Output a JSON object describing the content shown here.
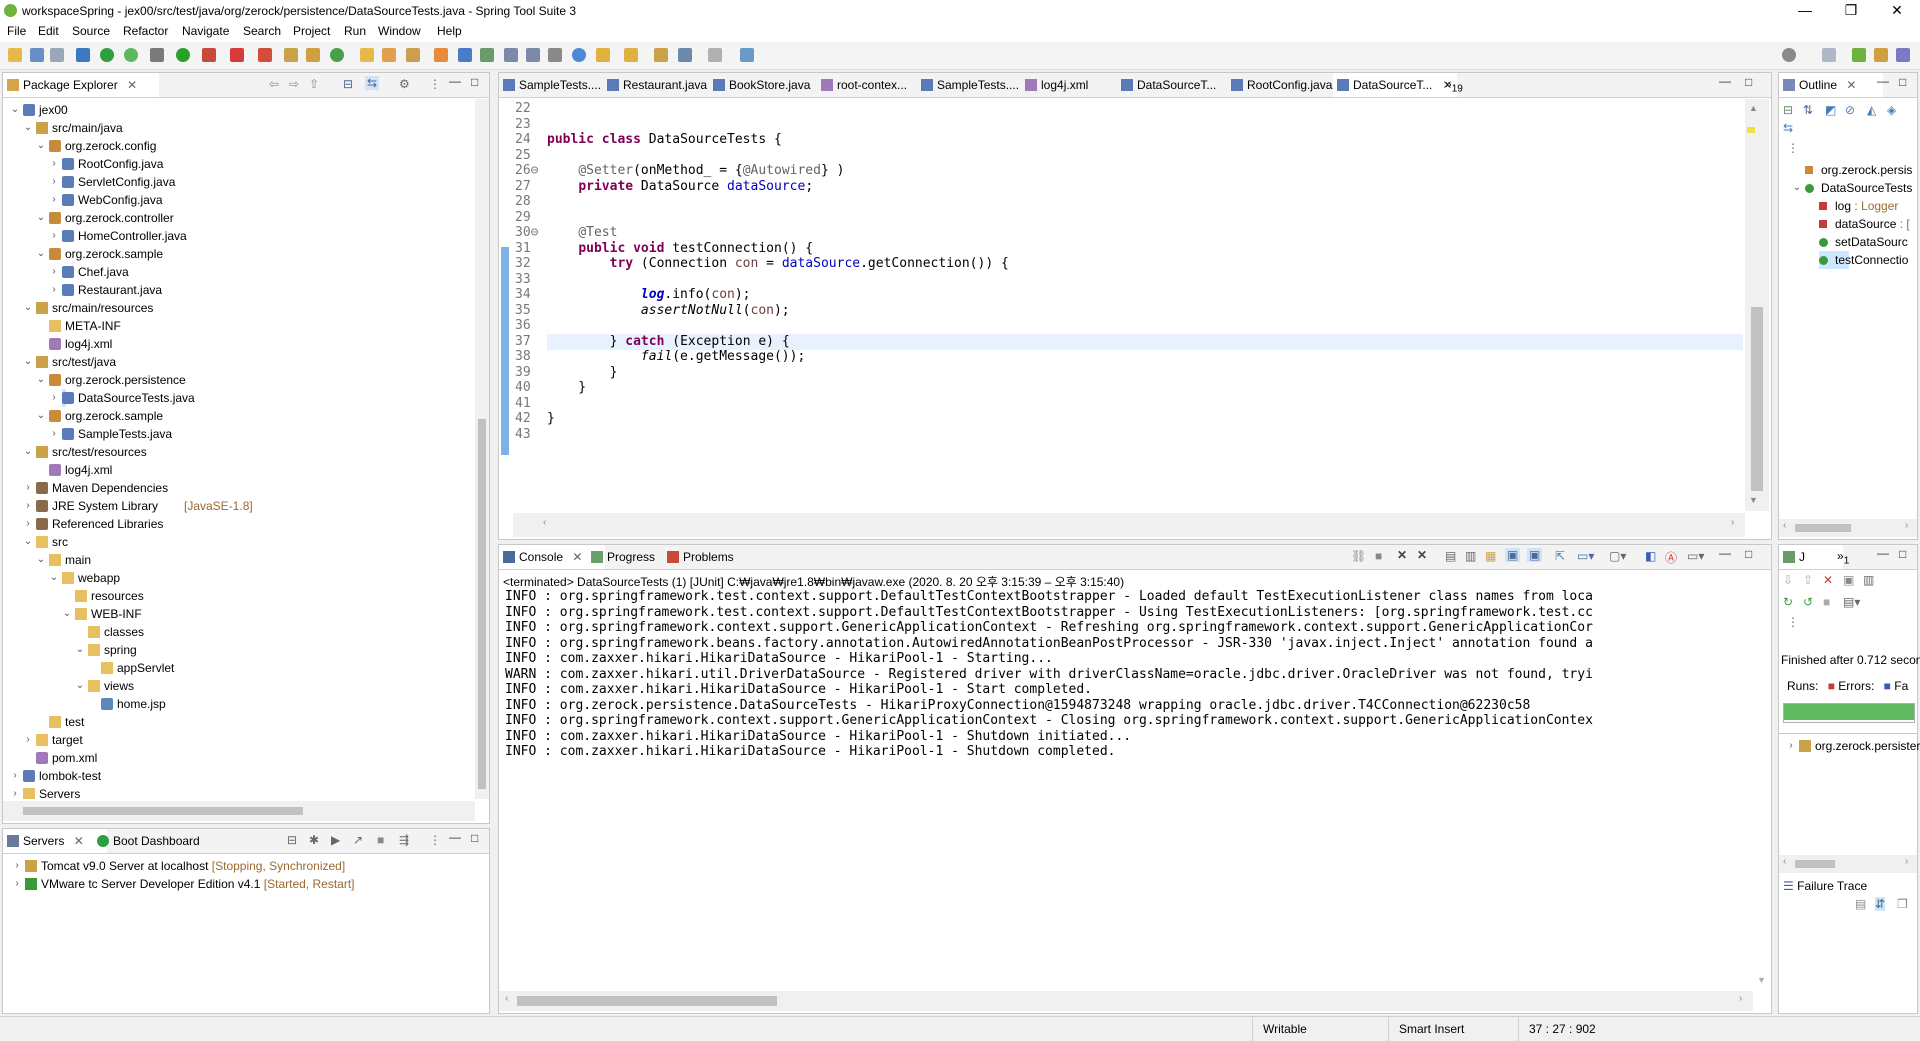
{
  "window": {
    "title": "workspaceSpring - jex00/src/test/java/org/zerock/persistence/DataSourceTests.java - Spring Tool Suite 3",
    "minimize": "—",
    "maximize": "❐",
    "close": "✕"
  },
  "menu": [
    "File",
    "Edit",
    "Source",
    "Refactor",
    "Navigate",
    "Search",
    "Project",
    "Run",
    "Window",
    "Help"
  ],
  "package_explorer": {
    "title": "Package Explorer",
    "items": [
      {
        "label": "jex00",
        "depth": 0,
        "arrow": "v",
        "icon": "project-icon"
      },
      {
        "label": "src/main/java",
        "depth": 1,
        "arrow": "v",
        "icon": "source-folder-icon"
      },
      {
        "label": "org.zerock.config",
        "depth": 2,
        "arrow": "v",
        "icon": "package-icon"
      },
      {
        "label": "RootConfig.java",
        "depth": 3,
        "arrow": ">",
        "icon": "java-file-icon"
      },
      {
        "label": "ServletConfig.java",
        "depth": 3,
        "arrow": ">",
        "icon": "java-file-icon"
      },
      {
        "label": "WebConfig.java",
        "depth": 3,
        "arrow": ">",
        "icon": "java-file-icon"
      },
      {
        "label": "org.zerock.controller",
        "depth": 2,
        "arrow": "v",
        "icon": "package-icon"
      },
      {
        "label": "HomeController.java",
        "depth": 3,
        "arrow": ">",
        "icon": "java-file-icon"
      },
      {
        "label": "org.zerock.sample",
        "depth": 2,
        "arrow": "v",
        "icon": "package-icon"
      },
      {
        "label": "Chef.java",
        "depth": 3,
        "arrow": ">",
        "icon": "java-file-icon"
      },
      {
        "label": "Restaurant.java",
        "depth": 3,
        "arrow": ">",
        "icon": "java-file-icon"
      },
      {
        "label": "src/main/resources",
        "depth": 1,
        "arrow": "v",
        "icon": "source-folder-icon"
      },
      {
        "label": "META-INF",
        "depth": 2,
        "arrow": "",
        "icon": "folder-icon"
      },
      {
        "label": "log4j.xml",
        "depth": 2,
        "arrow": "",
        "icon": "xml-file-icon"
      },
      {
        "label": "src/test/java",
        "depth": 1,
        "arrow": "v",
        "icon": "source-folder-icon"
      },
      {
        "label": "org.zerock.persistence",
        "depth": 2,
        "arrow": "v",
        "icon": "package-icon"
      },
      {
        "label": "DataSourceTests.java",
        "depth": 3,
        "arrow": ">",
        "icon": "java-file-icon",
        "selected": true
      },
      {
        "label": "org.zerock.sample",
        "depth": 2,
        "arrow": "v",
        "icon": "package-icon"
      },
      {
        "label": "SampleTests.java",
        "depth": 3,
        "arrow": ">",
        "icon": "java-file-icon"
      },
      {
        "label": "src/test/resources",
        "depth": 1,
        "arrow": "v",
        "icon": "source-folder-icon"
      },
      {
        "label": "log4j.xml",
        "depth": 2,
        "arrow": "",
        "icon": "xml-file-icon"
      },
      {
        "label": "Maven Dependencies",
        "depth": 1,
        "arrow": ">",
        "icon": "library-icon"
      },
      {
        "label": "JRE System Library",
        "depth": 1,
        "arrow": ">",
        "icon": "library-icon",
        "decoration": "[JavaSE-1.8]"
      },
      {
        "label": "Referenced Libraries",
        "depth": 1,
        "arrow": ">",
        "icon": "library-icon"
      },
      {
        "label": "src",
        "depth": 1,
        "arrow": "v",
        "icon": "folder-icon"
      },
      {
        "label": "main",
        "depth": 2,
        "arrow": "v",
        "icon": "folder-icon"
      },
      {
        "label": "webapp",
        "depth": 3,
        "arrow": "v",
        "icon": "folder-icon"
      },
      {
        "label": "resources",
        "depth": 4,
        "arrow": "",
        "icon": "folder-icon"
      },
      {
        "label": "WEB-INF",
        "depth": 4,
        "arrow": "v",
        "icon": "folder-icon"
      },
      {
        "label": "classes",
        "depth": 5,
        "arrow": "",
        "icon": "folder-icon"
      },
      {
        "label": "spring",
        "depth": 5,
        "arrow": "v",
        "icon": "folder-icon"
      },
      {
        "label": "appServlet",
        "depth": 6,
        "arrow": "",
        "icon": "folder-icon"
      },
      {
        "label": "views",
        "depth": 5,
        "arrow": "v",
        "icon": "folder-icon"
      },
      {
        "label": "home.jsp",
        "depth": 6,
        "arrow": "",
        "icon": "jsp-file-icon"
      },
      {
        "label": "test",
        "depth": 2,
        "arrow": "",
        "icon": "folder-icon"
      },
      {
        "label": "target",
        "depth": 1,
        "arrow": ">",
        "icon": "folder-icon"
      },
      {
        "label": "pom.xml",
        "depth": 1,
        "arrow": "",
        "icon": "xml-file-icon"
      },
      {
        "label": "lombok-test",
        "depth": 0,
        "arrow": ">",
        "icon": "project-icon"
      },
      {
        "label": "Servers",
        "depth": 0,
        "arrow": ">",
        "icon": "folder-icon"
      }
    ]
  },
  "servers_panel": {
    "tabs": [
      "Servers",
      "Boot Dashboard"
    ],
    "items": [
      {
        "label": "Tomcat v9.0 Server at localhost",
        "status": "[Stopping, Synchronized]"
      },
      {
        "label": "VMware tc Server Developer Edition v4.1",
        "status": "[Started, Restart]"
      }
    ]
  },
  "editor": {
    "tabs": [
      "SampleTests....",
      "Restaurant.java",
      "BookStore.java",
      "root-contex...",
      "SampleTests....",
      "log4j.xml",
      "DataSourceT...",
      "RootConfig.java",
      "DataSourceT..."
    ],
    "overflow": "»",
    "overflow_count": "19",
    "lines": [
      {
        "n": "22",
        "t": ""
      },
      {
        "n": "23",
        "t": ""
      },
      {
        "n": "24",
        "t": "public class DataSourceTests {"
      },
      {
        "n": "25",
        "t": ""
      },
      {
        "n": "26⊖",
        "t": "    @Setter(onMethod_ = {@Autowired} )"
      },
      {
        "n": "27",
        "t": "    private DataSource dataSource;"
      },
      {
        "n": "28",
        "t": ""
      },
      {
        "n": "29",
        "t": ""
      },
      {
        "n": "30⊖",
        "t": "    @Test"
      },
      {
        "n": "31",
        "t": "    public void testConnection() {"
      },
      {
        "n": "32",
        "t": "        try (Connection con = dataSource.getConnection()) {"
      },
      {
        "n": "33",
        "t": ""
      },
      {
        "n": "34",
        "t": "            log.info(con);"
      },
      {
        "n": "35",
        "t": "            assertNotNull(con);"
      },
      {
        "n": "36",
        "t": ""
      },
      {
        "n": "37",
        "t": "        } catch (Exception e) {"
      },
      {
        "n": "38",
        "t": "            fail(e.getMessage());"
      },
      {
        "n": "39",
        "t": "        }"
      },
      {
        "n": "40",
        "t": "    }"
      },
      {
        "n": "41",
        "t": ""
      },
      {
        "n": "42",
        "t": "}"
      },
      {
        "n": "43",
        "t": ""
      }
    ]
  },
  "console": {
    "tabs": [
      "Console",
      "Progress",
      "Problems"
    ],
    "header": "<terminated> DataSourceTests (1) [JUnit] C:₩java₩jre1.8₩bin₩javaw.exe  (2020. 8. 20 오후 3:15:39 – 오후 3:15:40)",
    "lines": [
      "INFO : org.springframework.test.context.support.DefaultTestContextBootstrapper - Loaded default TestExecutionListener class names from loca",
      "INFO : org.springframework.test.context.support.DefaultTestContextBootstrapper - Using TestExecutionListeners: [org.springframework.test.cc",
      "INFO : org.springframework.context.support.GenericApplicationContext - Refreshing org.springframework.context.support.GenericApplicationCor",
      "INFO : org.springframework.beans.factory.annotation.AutowiredAnnotationBeanPostProcessor - JSR-330 'javax.inject.Inject' annotation found a",
      "INFO : com.zaxxer.hikari.HikariDataSource - HikariPool-1 - Starting...",
      "WARN : com.zaxxer.hikari.util.DriverDataSource - Registered driver with driverClassName=oracle.jdbc.driver.OracleDriver was not found, tryi",
      "INFO : com.zaxxer.hikari.HikariDataSource - HikariPool-1 - Start completed.",
      "INFO : org.zerock.persistence.DataSourceTests - HikariProxyConnection@1594873248 wrapping oracle.jdbc.driver.T4CConnection@62230c58",
      "INFO : org.springframework.context.support.GenericApplicationContext - Closing org.springframework.context.support.GenericApplicationContex",
      "INFO : com.zaxxer.hikari.HikariDataSource - HikariPool-1 - Shutdown initiated...",
      "INFO : com.zaxxer.hikari.HikariDataSource - HikariPool-1 - Shutdown completed."
    ]
  },
  "outline": {
    "title": "Outline",
    "items": [
      {
        "label": "org.zerock.persis",
        "icon": "package-icon",
        "depth": 0
      },
      {
        "label": "DataSourceTests",
        "icon": "class-icon",
        "depth": 0,
        "arrow": "v"
      },
      {
        "label": "log",
        "type": " : Logger",
        "icon": "static-field-icon",
        "depth": 1
      },
      {
        "label": "dataSource",
        "type": " : [",
        "icon": "private-field-icon",
        "depth": 1
      },
      {
        "label": "setDataSourc",
        "icon": "public-method-icon",
        "depth": 1
      },
      {
        "label": "testConnectio",
        "icon": "public-method-icon",
        "depth": 1,
        "selected": true
      }
    ]
  },
  "junit": {
    "tab": "J",
    "overflow": "»",
    "overflow_count": "1",
    "finished": "Finished after 0.712 secon",
    "runs_label": "Runs:",
    "errors_label": "Errors:",
    "failures_label": "Fa",
    "progress": 1.0,
    "test_item": "org.zerock.persister",
    "failure_trace": "Failure Trace"
  },
  "status_bar": {
    "writable": "Writable",
    "insert_mode": "Smart Insert",
    "position": "37 : 27 : 902"
  },
  "colors": {
    "keyword": "#7f0055",
    "annotation": "#646464",
    "field": "#0000c0",
    "selection": "#cde8ff",
    "progress": "#5fb95f"
  }
}
